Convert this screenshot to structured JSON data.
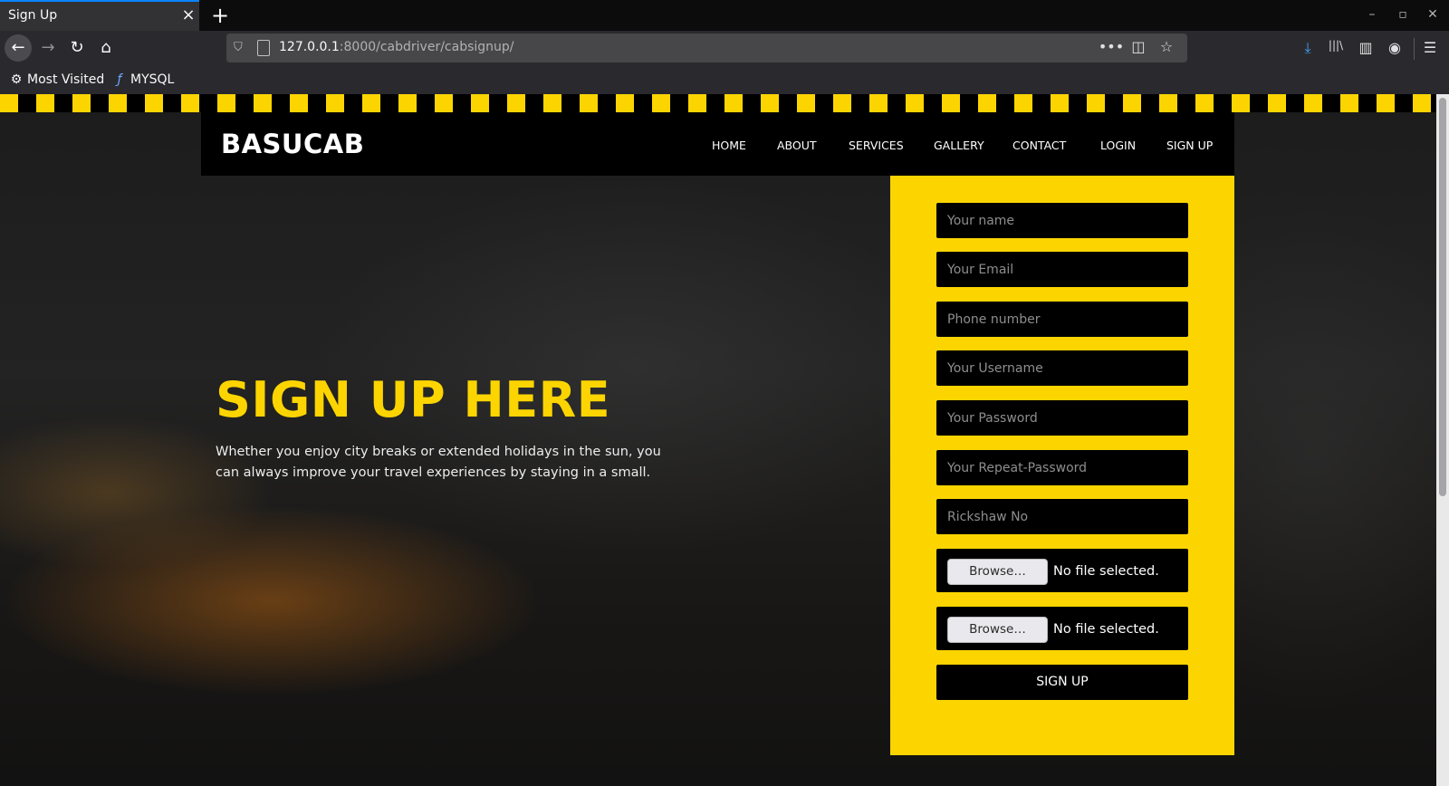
{
  "browser": {
    "tab_title": "Sign Up",
    "tab_close": "×",
    "new_tab": "+",
    "window_controls": [
      "–",
      "▫",
      "✕"
    ],
    "url_host": "127.0.0.1",
    "url_rest": ":8000/cabdriver/cabsignup/",
    "url_actions": [
      "•••",
      "◫",
      "☆"
    ],
    "toolbar_icons": [
      "⤓",
      "|||\\",
      "▥",
      "◉",
      "☰"
    ],
    "bookmarks": [
      {
        "icon": "⚙",
        "label": "Most Visited"
      },
      {
        "icon": "ƒ",
        "label": "MYSQL"
      }
    ]
  },
  "site": {
    "brand": "BASUCAB",
    "nav": [
      "HOME",
      "ABOUT",
      "SERVICES",
      "GALLERY",
      "CONTACT",
      "LOGIN",
      "SIGN UP"
    ]
  },
  "hero": {
    "title": "SIGN UP HERE",
    "text": "Whether you enjoy city breaks or extended holidays in the sun, you can always improve your travel experiences by staying in a small."
  },
  "form": {
    "placeholders": {
      "name": "Your name",
      "email": "Your Email",
      "phone": "Phone number",
      "username": "Your Username",
      "password": "Your Password",
      "repeat_password": "Your Repeat-Password",
      "rickshaw": "Rickshaw No"
    },
    "file_inputs": [
      {
        "button": "Browse…",
        "status": "No file selected."
      },
      {
        "button": "Browse…",
        "status": "No file selected."
      }
    ],
    "submit_label": "SIGN UP"
  },
  "colors": {
    "accent": "#fcd500",
    "header_bg": "#000000",
    "browser_chrome": "#2a2a2e"
  }
}
